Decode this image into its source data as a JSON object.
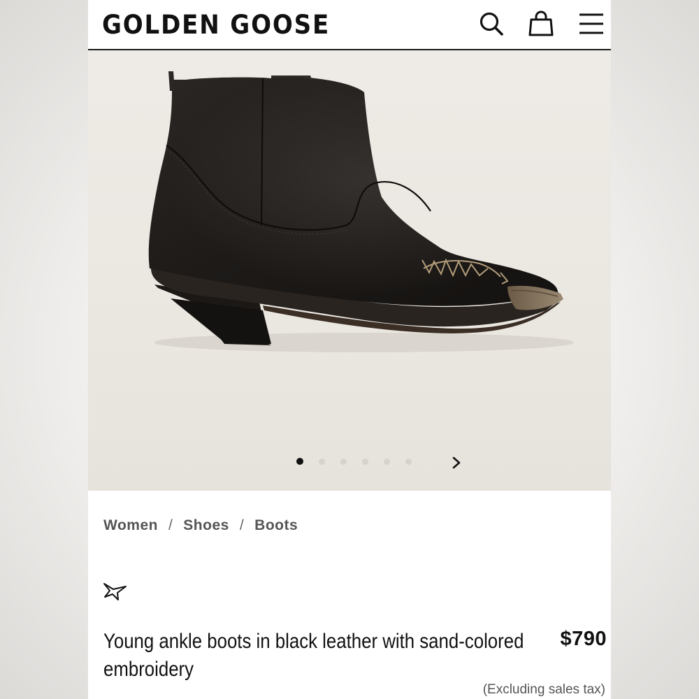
{
  "header": {
    "logo": "GOLDEN GOOSE",
    "icons": [
      "search-icon",
      "shopping-bag-icon",
      "hamburger-menu-icon"
    ]
  },
  "gallery": {
    "image_alt": "Black leather ankle boot with sand-colored embroidery",
    "slide_count": 6,
    "active_slide": 1
  },
  "breadcrumb": {
    "items": [
      "Women",
      "Shoes",
      "Boots"
    ],
    "separator": "/"
  },
  "product": {
    "wishlist_icon": "star-outline-icon",
    "title": "Young ankle boots in black leather with sand-colored embroidery",
    "price": "$790",
    "tax_note": "(Excluding sales tax)"
  },
  "colors": {
    "text": "#111111",
    "muted": "#555555",
    "hero_bg": "#ebe7e1",
    "dot_active": "#111111",
    "dot_inactive": "#d6d2cc"
  }
}
